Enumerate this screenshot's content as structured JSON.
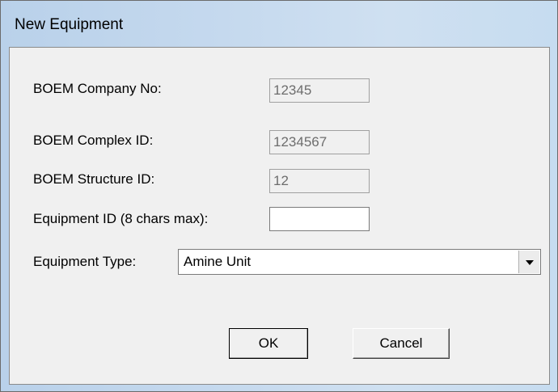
{
  "window": {
    "title": "New Equipment"
  },
  "form": {
    "company_no_label": "BOEM Company No:",
    "company_no_value": "12345",
    "complex_id_label": "BOEM Complex ID:",
    "complex_id_value": "1234567",
    "structure_id_label": "BOEM Structure ID:",
    "structure_id_value": "12",
    "equipment_id_label": "Equipment ID (8 chars max):",
    "equipment_id_value": "",
    "equipment_type_label": "Equipment Type:",
    "equipment_type_value": "Amine Unit"
  },
  "buttons": {
    "ok_label": "OK",
    "cancel_label": "Cancel"
  },
  "icons": {
    "dropdown": "chevron-down-icon"
  }
}
